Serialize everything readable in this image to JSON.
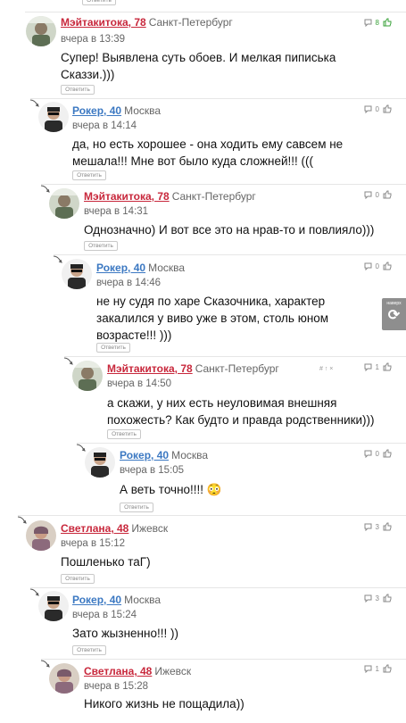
{
  "reply_label": "Ответить",
  "float_button": {
    "label": "наверх",
    "icon": "refresh-icon"
  },
  "comments": [
    {
      "author": "Мэйтакитока, 78",
      "city": "Санкт-Петербург",
      "time": "вчера в 13:39",
      "text": "Супер! Выявлена суть обоев. И мелкая пиписька Сказзи.)))",
      "votes": "8",
      "avatar": "user-photo"
    },
    {
      "author": "Рокер, 40",
      "city": "Москва",
      "time": "вчера в 14:14",
      "text": "да, но есть хорошее - она ходить ему савсем не мешала!!! Мне вот было куда сложней!!! (((",
      "votes": "0",
      "avatar": "rocker-photo"
    },
    {
      "author": "Мэйтакитока, 78",
      "city": "Санкт-Петербург",
      "time": "вчера в 14:31",
      "text": "Однозначно) И вот все это на нрав-то и повлияло)))",
      "votes": "0",
      "avatar": "user-photo"
    },
    {
      "author": "Рокер, 40",
      "city": "Москва",
      "time": "вчера в 14:46",
      "text": "не ну судя по харе Сказочника, характер закалился у виво уже в этом, столь юном возрасте!!! )))",
      "votes": "0",
      "avatar": "rocker-photo"
    },
    {
      "author": "Мэйтакитока, 78",
      "city": "Санкт-Петербург",
      "time": "вчера в 14:50",
      "text": "а скажи, у них есть неуловимая внешняя похожесть? Как будто и правда родственники)))",
      "votes": "1",
      "avatar": "user-photo",
      "extra": "# ↑ ×"
    },
    {
      "author": "Рокер, 40",
      "city": "Москва",
      "time": "вчера в 15:05",
      "text": "А веть точно!!!! 😳",
      "votes": "0",
      "avatar": "rocker-photo"
    },
    {
      "author": "Светлана, 48",
      "city": "Ижевск",
      "time": "вчера в 15:12",
      "text": "Пошленько таГ)",
      "votes": "3",
      "avatar": "svetlana-photo"
    },
    {
      "author": "Рокер, 40",
      "city": "Москва",
      "time": "вчера в 15:24",
      "text": "Зато жызненно!!! ))",
      "votes": "3",
      "avatar": "rocker-photo"
    },
    {
      "author": "Светлана, 48",
      "city": "Ижевск",
      "time": "вчера в 15:28",
      "text": "Никого жизнь не пощадила))",
      "votes": "1",
      "avatar": "svetlana-photo"
    }
  ]
}
